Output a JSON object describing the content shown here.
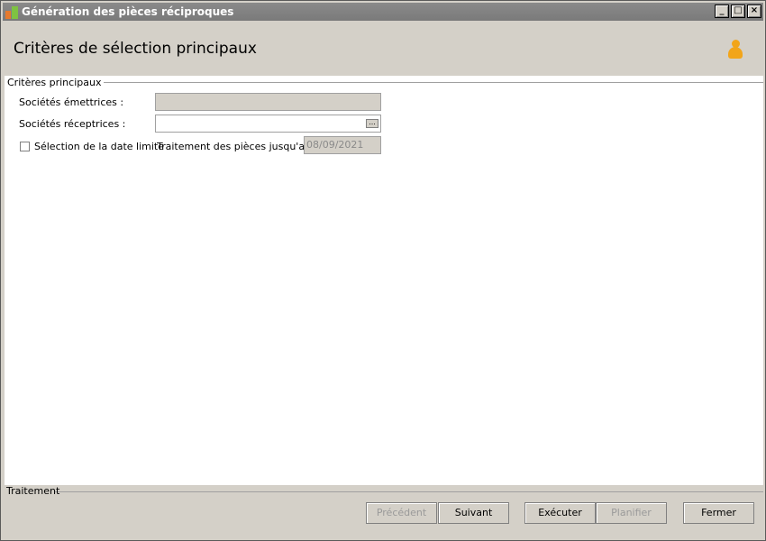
{
  "window": {
    "title": "Génération des pièces réciproques"
  },
  "header": {
    "title": "Critères de sélection principaux"
  },
  "criteria": {
    "group_label": "Critères principaux",
    "issuing_label": "Sociétés émettrices :",
    "issuing_value": "",
    "receiving_label": "Sociétés réceptrices :",
    "receiving_value": "",
    "ellipsis": "...",
    "date_limit_label": "Sélection de la date limite",
    "processing_label": "Traitement des pièces jusqu'au :",
    "processing_date": "08/09/2021"
  },
  "bottom": {
    "group_label": "Traitement",
    "buttons": {
      "previous": "Précédent",
      "next": "Suivant",
      "execute": "Exécuter",
      "schedule": "Planifier",
      "close": "Fermer"
    }
  }
}
